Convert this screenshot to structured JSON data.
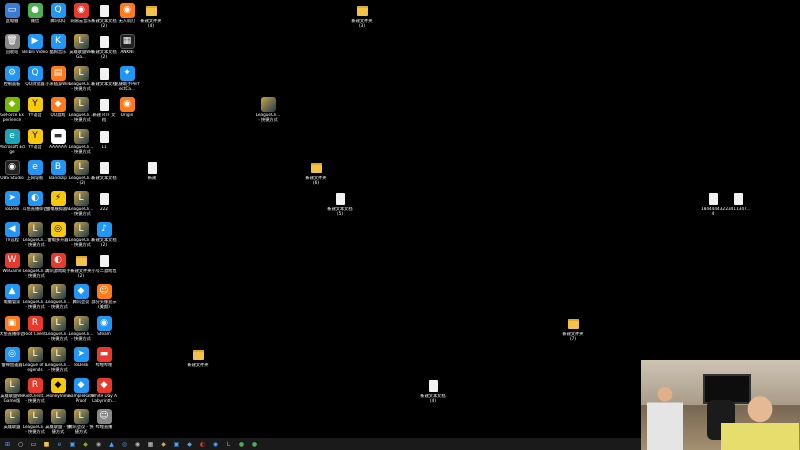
{
  "desktop": {
    "icons": [
      {
        "id": "c1r1",
        "label": "此电脑",
        "glyph": "▭",
        "style": "g-app"
      },
      {
        "id": "c1r2",
        "label": "回收站",
        "glyph": "🗑",
        "style": "g-grey"
      },
      {
        "id": "c1r3",
        "label": "控制面板",
        "glyph": "⚙",
        "style": "g-blue"
      },
      {
        "id": "c1r4",
        "label": "GeForce Experience",
        "glyph": "◆",
        "style": "g-nvidia"
      },
      {
        "id": "c1r5",
        "label": "Microsoft Edge",
        "glyph": "e",
        "style": "g-teal"
      },
      {
        "id": "c1r6",
        "label": "OBS Studio",
        "glyph": "◉",
        "style": "g-dark"
      },
      {
        "id": "c1r7",
        "label": "ToDesk",
        "glyph": "➤",
        "style": "g-blue"
      },
      {
        "id": "c1r8",
        "label": "TV远程",
        "glyph": "◀",
        "style": "g-blue"
      },
      {
        "id": "c1r9",
        "label": "WeGame",
        "glyph": "W",
        "style": "g-red"
      },
      {
        "id": "c1r10",
        "label": "电脑管家",
        "glyph": "▲",
        "style": "g-blue"
      },
      {
        "id": "c1r11",
        "label": "大鱼直播伴侣",
        "glyph": "▣",
        "style": "g-orange"
      },
      {
        "id": "c1r12",
        "label": "雷神加速器",
        "glyph": "◎",
        "style": "g-blue"
      },
      {
        "id": "c1r13",
        "label": "英雄联盟WeGame版",
        "glyph": "L",
        "style": "g-league"
      },
      {
        "id": "c1r14",
        "label": "英雄联盟",
        "glyph": "L",
        "style": "g-league"
      },
      {
        "id": "c2r1",
        "label": "微信",
        "glyph": "●",
        "style": "g-green"
      },
      {
        "id": "c2r2",
        "label": "Bilibili Video",
        "glyph": "▶",
        "style": "g-blue"
      },
      {
        "id": "c2r3",
        "label": "QQ浏览器",
        "glyph": "Q",
        "style": "g-blue"
      },
      {
        "id": "c2r4",
        "label": "YY语音",
        "glyph": "Y",
        "style": "g-yellow"
      },
      {
        "id": "c2r5",
        "label": "YY语音",
        "glyph": "Y",
        "style": "g-yellow"
      },
      {
        "id": "c2r6",
        "label": "上网导航",
        "glyph": "e",
        "style": "g-blue"
      },
      {
        "id": "c2r7",
        "label": "斗鱼直播伴侣",
        "glyph": "◐",
        "style": "g-blue"
      },
      {
        "id": "c2r8",
        "label": "LeagueCli... - 快捷方式",
        "glyph": "L",
        "style": "g-league"
      },
      {
        "id": "c2r9",
        "label": "LeagueCli... - 快捷方式",
        "glyph": "L",
        "style": "g-league"
      },
      {
        "id": "c2r10",
        "label": "LeagueCli... - 快捷方式",
        "glyph": "L",
        "style": "g-league"
      },
      {
        "id": "c2r11",
        "label": "Riot Client",
        "glyph": "R",
        "style": "g-red"
      },
      {
        "id": "c2r12",
        "label": "League of Legends",
        "glyph": "L",
        "style": "g-league"
      },
      {
        "id": "c2r13",
        "label": "RiotClient... - 快捷方式",
        "glyph": "R",
        "style": "g-red"
      },
      {
        "id": "c2r14",
        "label": "LeagueCli... - 快捷方式",
        "glyph": "L",
        "style": "g-league"
      },
      {
        "id": "c3r1",
        "label": "腾讯QQ",
        "glyph": "Q",
        "style": "g-blue"
      },
      {
        "id": "c3r2",
        "label": "酷狗音乐",
        "glyph": "K",
        "style": "g-blue"
      },
      {
        "id": "c3r3",
        "label": "小米随身WiFi",
        "glyph": "▤",
        "style": "g-orange"
      },
      {
        "id": "c3r4",
        "label": "QQ游戏",
        "glyph": "◆",
        "style": "g-orange"
      },
      {
        "id": "c3r5",
        "label": "AAAAAA",
        "glyph": "▬",
        "style": "g-white"
      },
      {
        "id": "c3r6",
        "label": "Bandizip",
        "glyph": "B",
        "style": "g-blue"
      },
      {
        "id": "c3r7",
        "label": "雷电模拟器9",
        "glyph": "⚡",
        "style": "g-yellow"
      },
      {
        "id": "c3r8",
        "label": "雷电多开器",
        "glyph": "◎",
        "style": "g-yellow"
      },
      {
        "id": "c3r9",
        "label": "腾讯游戏助手",
        "glyph": "◐",
        "style": "g-red"
      },
      {
        "id": "c3r10",
        "label": "LeagueCli... - 快捷方式",
        "glyph": "L",
        "style": "g-league"
      },
      {
        "id": "c3r11",
        "label": "LeagueCli... - 快捷方式",
        "glyph": "L",
        "style": "g-league"
      },
      {
        "id": "c3r12",
        "label": "LeagueCli... - 快捷方式",
        "glyph": "L",
        "style": "g-league"
      },
      {
        "id": "c3r13",
        "label": "HoneyView",
        "glyph": "◆",
        "style": "g-yellow"
      },
      {
        "id": "c3r14",
        "label": "英雄联盟 - 快捷方式",
        "glyph": "L",
        "style": "g-league"
      },
      {
        "id": "c4r1",
        "label": "网易云音乐",
        "glyph": "◉",
        "style": "g-red"
      },
      {
        "id": "c4r2",
        "label": "英雄联盟WeGa...",
        "glyph": "L",
        "style": "g-league"
      },
      {
        "id": "c4r3",
        "label": "LeagueCli... - 快捷方式",
        "glyph": "L",
        "style": "g-league"
      },
      {
        "id": "c4r4",
        "label": "LeagueCli... - 快捷方式",
        "glyph": "L",
        "style": "g-league"
      },
      {
        "id": "c4r5",
        "label": "LeagueCli... - 快捷方式",
        "glyph": "L",
        "style": "g-league"
      },
      {
        "id": "c4r6",
        "label": "LeagueCli... - (2)",
        "glyph": "L",
        "style": "g-league"
      },
      {
        "id": "c4r7",
        "label": "LeagueCli... - 快捷方式",
        "glyph": "L",
        "style": "g-league"
      },
      {
        "id": "c4r8",
        "label": "LeagueCli... - 快捷方式",
        "glyph": "L",
        "style": "g-league"
      },
      {
        "id": "c4r9",
        "label": "新建文件夹 (2)",
        "glyph": "",
        "style": "g-folder"
      },
      {
        "id": "c4r10",
        "label": "腾讯会议",
        "glyph": "◆",
        "style": "g-blue"
      },
      {
        "id": "c4r11",
        "label": "LeagueCli... - 快捷方式",
        "glyph": "L",
        "style": "g-league"
      },
      {
        "id": "c4r12",
        "label": "ToDesk",
        "glyph": "➤",
        "style": "g-blue"
      },
      {
        "id": "c4r13",
        "label": "SampleRate Proof",
        "glyph": "◆",
        "style": "g-blue"
      },
      {
        "id": "c4r14",
        "label": "腾讯会议 - 快捷方式",
        "glyph": "L",
        "style": "g-league"
      },
      {
        "id": "c5r1",
        "label": "新建文本文档(2)",
        "glyph": "",
        "style": "g-file"
      },
      {
        "id": "c5r2",
        "label": "新建文本文档 (2)",
        "glyph": "",
        "style": "g-file"
      },
      {
        "id": "c5r3",
        "label": "新建文本文档",
        "glyph": "",
        "style": "g-file"
      },
      {
        "id": "c5r4",
        "label": "新建 RTF 文档",
        "glyph": "",
        "style": "g-file"
      },
      {
        "id": "c5r5",
        "label": "11",
        "glyph": "",
        "style": "g-file"
      },
      {
        "id": "c5r6",
        "label": "新建文本文档",
        "glyph": "",
        "style": "g-file"
      },
      {
        "id": "c5r7",
        "label": "222",
        "glyph": "",
        "style": "g-file"
      },
      {
        "id": "c5r8",
        "label": "新建文本文档(2)",
        "glyph": "♪",
        "style": "g-blue"
      },
      {
        "id": "c5r9",
        "label": "小号二游戏包",
        "glyph": "",
        "style": "g-file"
      },
      {
        "id": "c5r10",
        "label": "部分头像显示(美颜)",
        "glyph": "☺",
        "style": "g-orange"
      },
      {
        "id": "c5r11",
        "label": "Steam",
        "glyph": "◉",
        "style": "g-blue"
      },
      {
        "id": "c5r12",
        "label": "哔哩哔哩",
        "glyph": "▬",
        "style": "g-red"
      },
      {
        "id": "c5r13",
        "label": "White Day A Labyrinth...",
        "glyph": "◆",
        "style": "g-red"
      },
      {
        "id": "c5r14",
        "label": "哔哩直播",
        "glyph": "☺",
        "style": "g-grey"
      },
      {
        "id": "c6r1",
        "label": "无人机打",
        "glyph": "◉",
        "style": "g-orange"
      },
      {
        "id": "c6r2",
        "label": "ANKNI",
        "glyph": "▦",
        "style": "g-dark"
      },
      {
        "id": "c6r3",
        "label": "迅捷助手PerfectCa...",
        "glyph": "✦",
        "style": "g-blue"
      },
      {
        "id": "c6r4",
        "label": "Origin",
        "glyph": "◉",
        "style": "g-orange"
      }
    ],
    "scattered": [
      {
        "id": "s1",
        "label": "新建文件夹 (4)",
        "style": "g-folder"
      },
      {
        "id": "s2",
        "label": "新建文件夹 (3)",
        "style": "g-folder"
      },
      {
        "id": "s3",
        "label": "LeagueCli... - 快捷方式",
        "style": "g-league"
      },
      {
        "id": "s4",
        "label": "新建",
        "style": "g-file"
      },
      {
        "id": "s5",
        "label": "新建文件夹 (6)",
        "style": "g-folder"
      },
      {
        "id": "s6",
        "label": "新建文本文档 (5)",
        "style": "g-file"
      },
      {
        "id": "s7",
        "label": "1844444324",
        "style": "g-file"
      },
      {
        "id": "s8",
        "label": "23411347...",
        "style": "g-file"
      },
      {
        "id": "s9",
        "label": "新建文件夹 (7)",
        "style": "g-folder"
      },
      {
        "id": "s10",
        "label": "新建文件夹",
        "style": "g-folder"
      },
      {
        "id": "s11",
        "label": "新建文本文档 (4)",
        "style": "g-file"
      }
    ]
  },
  "taskbar": {
    "items": [
      {
        "name": "start",
        "glyph": "⊞",
        "color": "#4fa3ff"
      },
      {
        "name": "search",
        "glyph": "○",
        "color": "#ddd"
      },
      {
        "name": "task-view",
        "glyph": "▭",
        "color": "#ddd"
      },
      {
        "name": "file-explorer",
        "glyph": "■",
        "color": "#f3c24a"
      },
      {
        "name": "edge",
        "glyph": "e",
        "color": "#1aa6b7"
      },
      {
        "name": "store",
        "glyph": "▣",
        "color": "#4fa3ff"
      },
      {
        "name": "app-1",
        "glyph": "◆",
        "color": "#76b900"
      },
      {
        "name": "app-2",
        "glyph": "◉",
        "color": "#aaa"
      },
      {
        "name": "app-3",
        "glyph": "▲",
        "color": "#4fa3ff"
      },
      {
        "name": "app-4",
        "glyph": "◎",
        "color": "#4fa3ff"
      },
      {
        "name": "obs",
        "glyph": "◉",
        "color": "#bbb"
      },
      {
        "name": "app-5",
        "glyph": "▦",
        "color": "#ccc"
      },
      {
        "name": "app-6",
        "glyph": "◆",
        "color": "#caa54b"
      },
      {
        "name": "app-7",
        "glyph": "▣",
        "color": "#4fa3ff"
      },
      {
        "name": "app-8",
        "glyph": "◆",
        "color": "#4fa3ff"
      },
      {
        "name": "app-9",
        "glyph": "◐",
        "color": "#e8392c"
      },
      {
        "name": "app-10",
        "glyph": "◉",
        "color": "#4fa3ff"
      },
      {
        "name": "app-11",
        "glyph": "L",
        "color": "#caa54b"
      },
      {
        "name": "app-12",
        "glyph": "●",
        "color": "#4caf50"
      },
      {
        "name": "wechat",
        "glyph": "●",
        "color": "#4caf50"
      }
    ]
  },
  "colors": {
    "desktop_bg": "#000000",
    "taskbar_bg": "#1a1a1a"
  }
}
